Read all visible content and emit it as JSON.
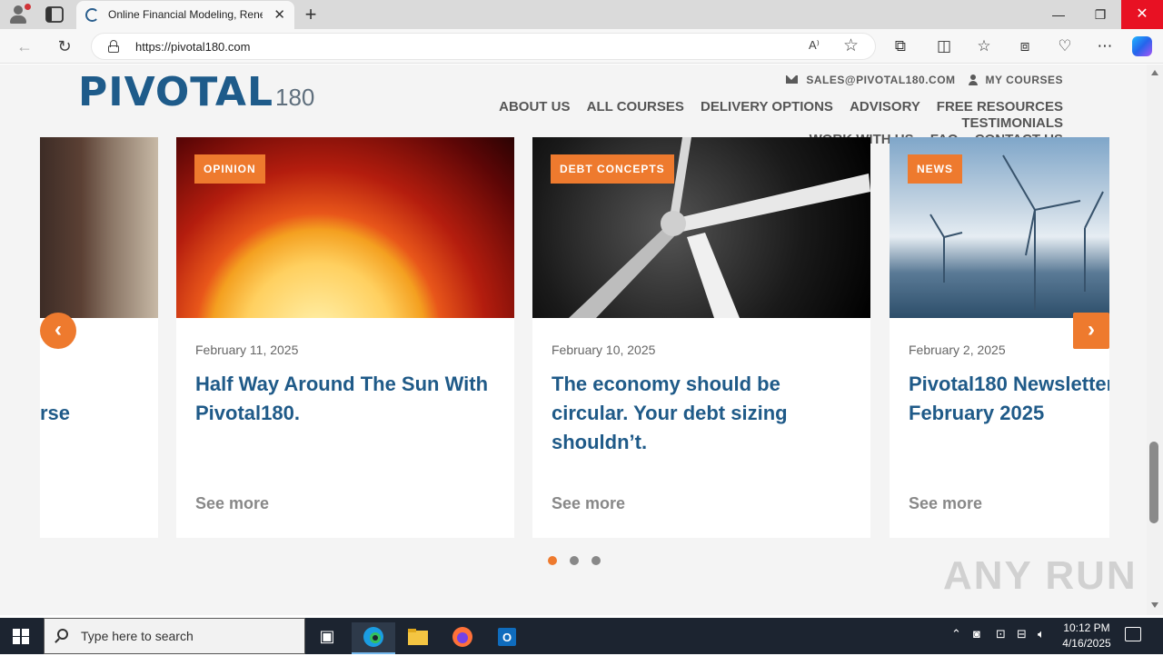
{
  "browser": {
    "tab_title": "Online Financial Modeling, Rene",
    "url": "https://pivotal180.com",
    "read_aloud": "A)"
  },
  "site": {
    "logo_main": "PIVOTAL",
    "logo_number": "180",
    "email": "SALES@PIVOTAL180.COM",
    "my_courses": "MY COURSES",
    "nav": [
      "ABOUT US",
      "ALL COURSES",
      "DELIVERY OPTIONS",
      "ADVISORY",
      "FREE RESOURCES",
      "TESTIMONIALS",
      "WORK WITH US",
      "FAQ",
      "CONTACT US"
    ]
  },
  "carousel": {
    "partial_card_title": "rse",
    "cards": [
      {
        "badge": "OPINION",
        "date": "February 11, 2025",
        "title": "Half Way Around The Sun With Pivotal180.",
        "more": "See more"
      },
      {
        "badge": "DEBT CONCEPTS",
        "date": "February 10, 2025",
        "title": "The economy should be circular. Your debt sizing shouldn’t.",
        "more": "See more"
      },
      {
        "badge": "NEWS",
        "date": "February 2, 2025",
        "title": "Pivotal180 Newsletter February 2025",
        "more": "See more"
      }
    ],
    "dots": 3,
    "active_dot": 0
  },
  "watermark": "ANY RUN",
  "taskbar": {
    "search_placeholder": "Type here to search",
    "time": "10:12 PM",
    "date": "4/16/2025"
  },
  "colors": {
    "accent": "#ee7a2e",
    "brand": "#1f5a88"
  }
}
